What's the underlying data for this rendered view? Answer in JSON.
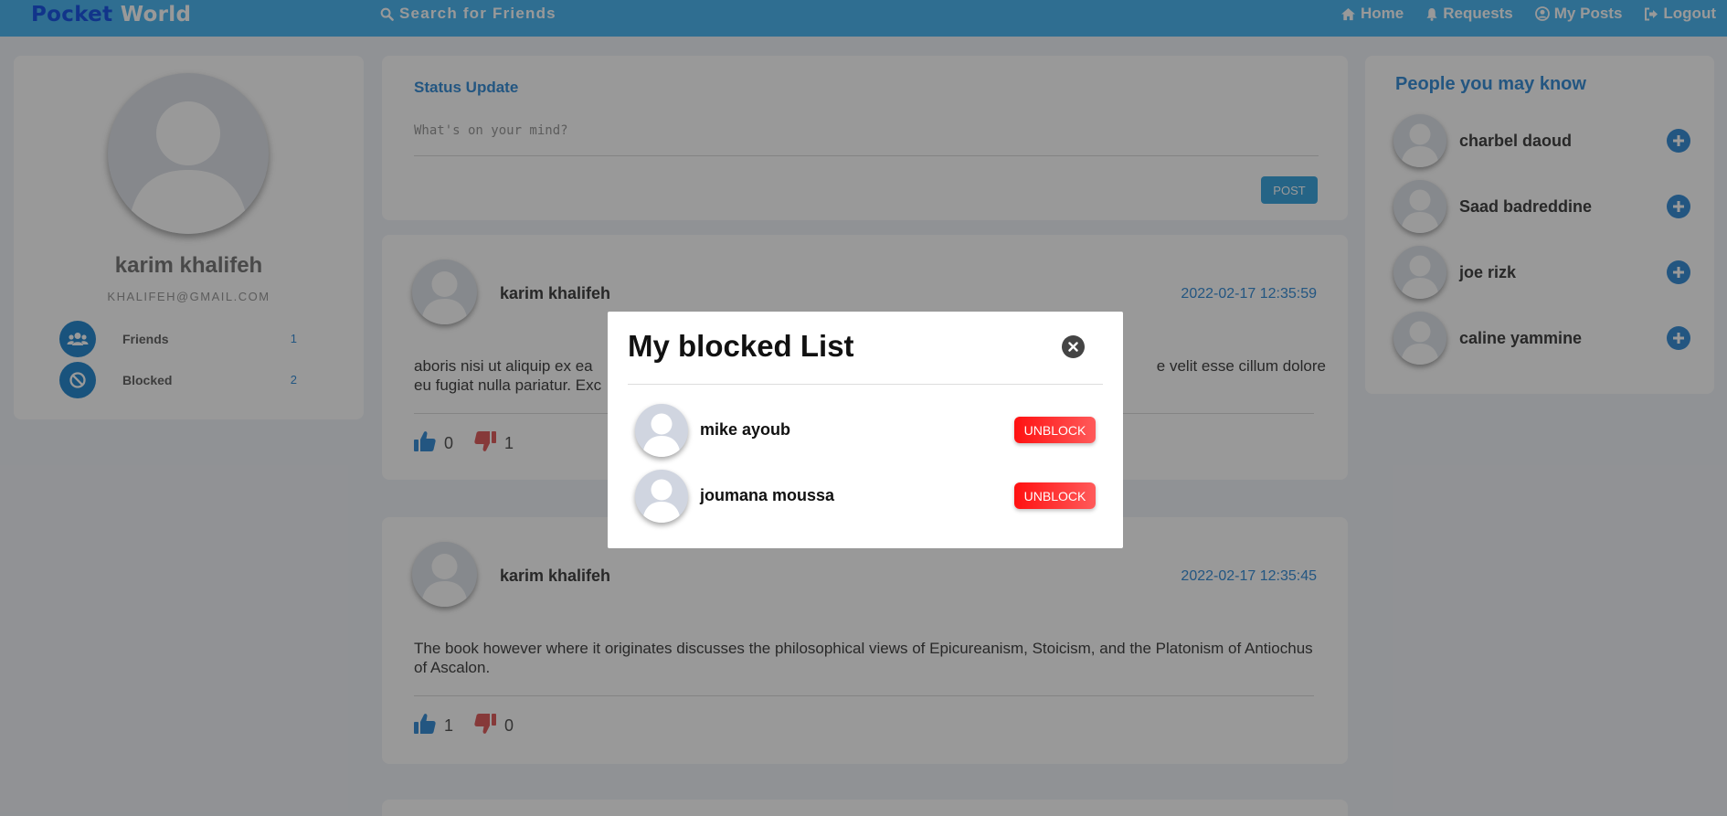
{
  "navbar": {
    "brand_part1": "Pocket",
    "brand_part2": "World",
    "search_label": "Search for Friends",
    "items": [
      {
        "label": "Home",
        "icon": "home-icon"
      },
      {
        "label": "Requests",
        "icon": "bell-icon"
      },
      {
        "label": "My Posts",
        "icon": "user-circle-icon"
      },
      {
        "label": "Logout",
        "icon": "logout-icon"
      }
    ]
  },
  "profile": {
    "name": "karim khalifeh",
    "email": "KHALIFEH@GMAIL.COM",
    "stats": [
      {
        "label": "Friends",
        "count": "1",
        "icon": "users-icon"
      },
      {
        "label": "Blocked",
        "count": "2",
        "icon": "ban-icon"
      }
    ]
  },
  "status_update": {
    "title": "Status Update",
    "placeholder": "What's on your mind?",
    "post_label": "POST"
  },
  "posts": [
    {
      "author": "karim khalifeh",
      "date": "2022-02-17 12:35:59",
      "text_visible_left": "aboris nisi ut aliquip ex ea",
      "text_visible_right": "e velit esse cillum dolore",
      "text_visible_line2": "eu fugiat nulla pariatur. Exc",
      "likes": "0",
      "dislikes": "1"
    },
    {
      "author": "karim khalifeh",
      "date": "2022-02-17 12:35:45",
      "text": "The book however where it originates discusses the philosophical views of Epicureanism, Stoicism, and the Platonism of Antiochus of Ascalon.",
      "likes": "1",
      "dislikes": "0"
    }
  ],
  "suggestions": {
    "title": "People you may know",
    "people": [
      {
        "name": "charbel daoud"
      },
      {
        "name": "Saad badreddine"
      },
      {
        "name": "joe rizk"
      },
      {
        "name": "caline yammine"
      }
    ]
  },
  "modal": {
    "title": "My blocked List",
    "blocked": [
      {
        "name": "mike ayoub",
        "button": "UNBLOCK"
      },
      {
        "name": "joumana moussa",
        "button": "UNBLOCK"
      }
    ]
  },
  "colors": {
    "navbar": "#4fb7f2",
    "accent": "#3b8fd8",
    "unblock": "#ff1111"
  }
}
